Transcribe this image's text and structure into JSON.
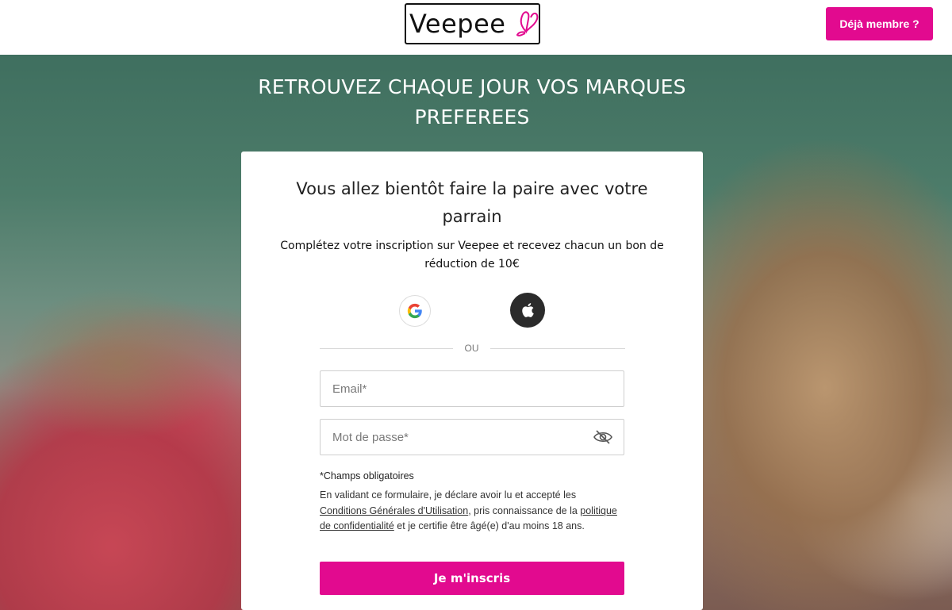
{
  "header": {
    "logo_text": "Veepee",
    "member_button": "Déjà membre ?"
  },
  "hero": {
    "title": "RETROUVEZ CHAQUE JOUR VOS MARQUES PREFEREES"
  },
  "card": {
    "title": "Vous allez bientôt faire la paire  avec votre parrain",
    "subtitle": "Complétez votre inscription sur Veepee et recevez chacun un bon de réduction de 10€",
    "separator": "OU",
    "email_placeholder": "Email*",
    "password_placeholder": "Mot de passe*",
    "required_note": "*Champs obligatoires",
    "legal": {
      "part1": "En validant ce formulaire, je déclare avoir lu et accepté les ",
      "cgu_link": "Conditions Générales d'Utilisation",
      "part2": ", pris connaissance de la ",
      "privacy_link": "politique de confidentialité",
      "part3": " et je certifie être âgé(e) d'au moins 18 ans."
    },
    "submit_label": "Je m'inscris"
  },
  "colors": {
    "accent": "#e20a8f",
    "google_blue": "#4285F4",
    "google_red": "#EA4335",
    "google_yellow": "#FBBC05",
    "google_green": "#34A853",
    "apple_bg": "#2b2b2b"
  },
  "icons": {
    "logo_mark": "butterfly-icon",
    "google": "google-icon",
    "apple": "apple-icon",
    "password_toggle": "eye-slash-icon"
  }
}
